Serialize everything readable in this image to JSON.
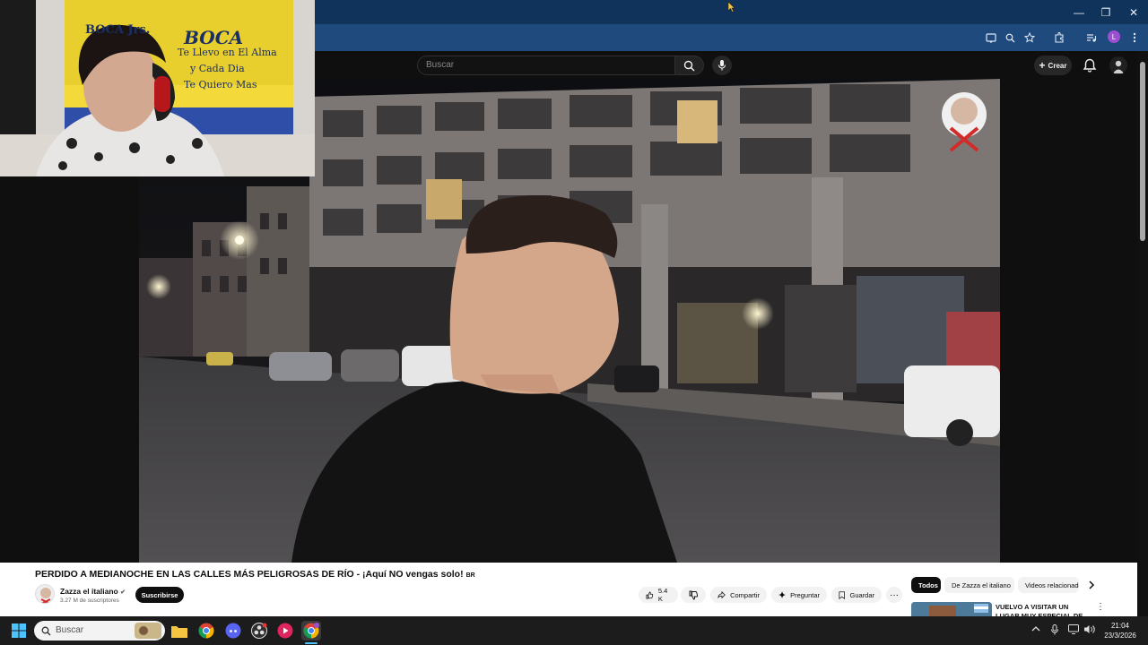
{
  "colors": {
    "title_bar": "#10335c",
    "toolbar": "#1e4a7d",
    "yt_background": "#0f0f0f",
    "subscribe_button": "#0f0f0f",
    "profile_badge": "#9c4fd1"
  },
  "window_controls": {
    "minimize": "—",
    "restore": "❐",
    "close": "✕"
  },
  "chrome_toolbar": {
    "profile_initial": "L",
    "icons": [
      "cast-icon",
      "zoom-icon",
      "bookmark-star-icon",
      "extensions-icon",
      "media-controls-icon",
      "menu-dots-icon"
    ]
  },
  "youtube_header": {
    "search_placeholder": "Buscar",
    "create_label": "Crear"
  },
  "webcam": {
    "banner_text": [
      "BOCA Jrs.",
      "BOCA",
      "Te Llevo en El Alma",
      "y Cada Dia",
      "Te Quiero Mas"
    ]
  },
  "video": {
    "title": "PERDIDO A MEDIANOCHE EN LAS CALLES MÁS PELIGROSAS DE RÍO - ¡Aquí NO vengas solo!",
    "title_tag": "BR",
    "channel_name": "Zazza el italiano",
    "verified": "✔",
    "subscribers": "3.27 M de suscriptores",
    "subscribe_label": "Suscribirse",
    "likes": "5.4 K",
    "share_label": "Compartir",
    "ask_label": "Preguntar",
    "save_label": "Guardar",
    "more_label": "···"
  },
  "related": {
    "chips": [
      "Todos",
      "De Zazza el italiano",
      "Videos relacionados"
    ],
    "first_title": "VUELVO A VISITAR UN LUGAR MUY ESPECIAL DE ARGENTIN..."
  },
  "taskbar": {
    "search_placeholder": "Buscar",
    "time": "21:04",
    "date": "23/3/2026"
  }
}
